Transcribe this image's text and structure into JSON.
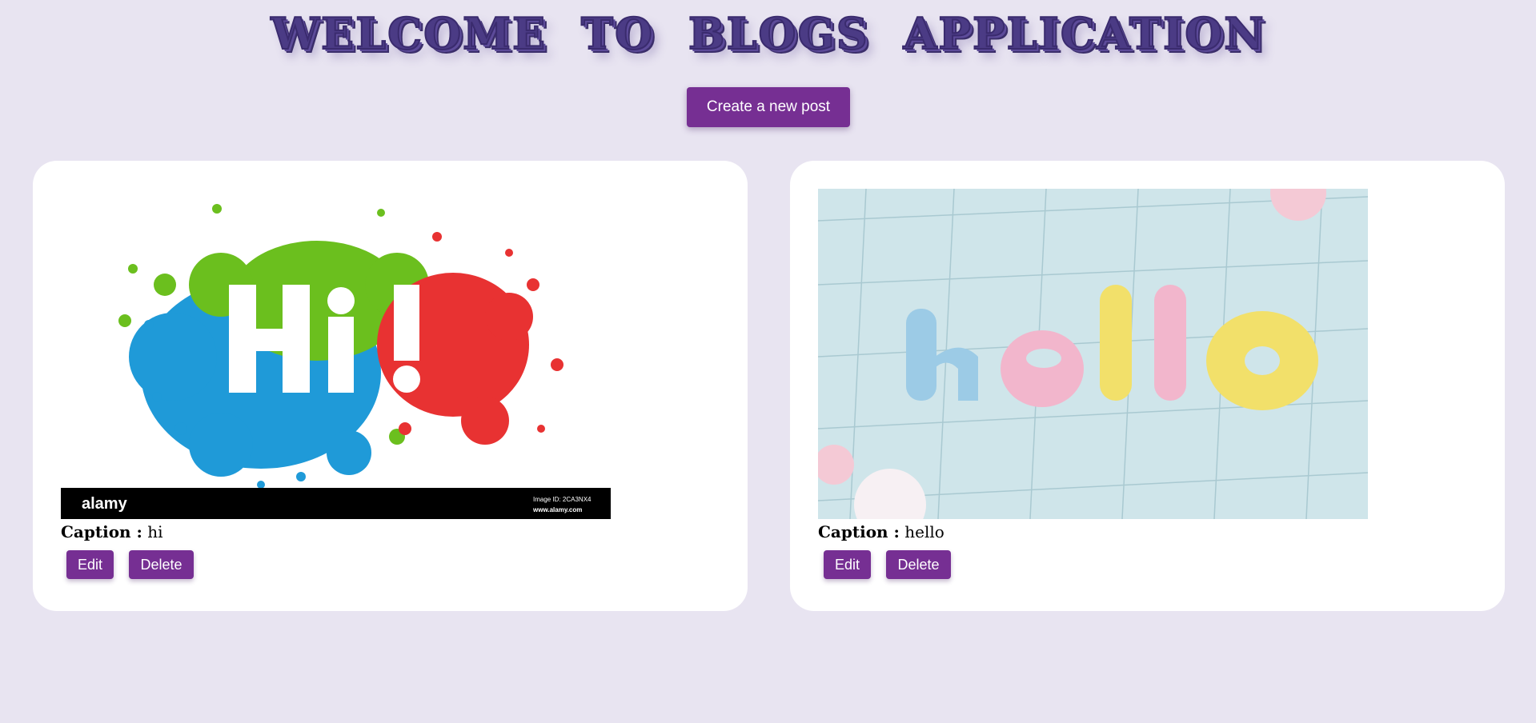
{
  "header": {
    "title": "WELCOME TO BLOGS APPLICATION",
    "create_button_label": "Create a new post"
  },
  "posts": [
    {
      "image_text": "Hi!",
      "image_watermark": "alamy",
      "image_id_text": "Image ID: 2CA3NX4",
      "image_url_text": "www.alamy.com",
      "caption_label": "Caption :",
      "caption_value": "hi",
      "edit_label": "Edit",
      "delete_label": "Delete"
    },
    {
      "image_text": "hello",
      "caption_label": "Caption :",
      "caption_value": "hello",
      "edit_label": "Edit",
      "delete_label": "Delete"
    }
  ],
  "colors": {
    "background": "#e8e4f1",
    "button": "#762f93",
    "title": "#4b3b85",
    "card": "#ffffff"
  }
}
